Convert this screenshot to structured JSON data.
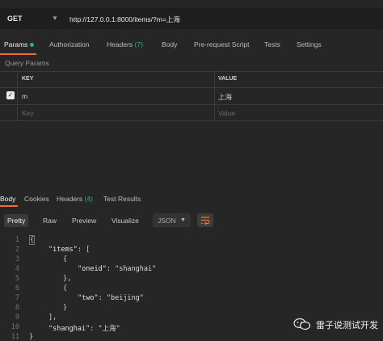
{
  "request": {
    "method": "GET",
    "url": "http://127.0.0.1:8000/items/?m=上海"
  },
  "tabs": [
    {
      "label": "Params"
    },
    {
      "label": "Authorization"
    },
    {
      "label": "Headers",
      "count": "(7)"
    },
    {
      "label": "Body"
    },
    {
      "label": "Pre-request Script"
    },
    {
      "label": "Tests"
    },
    {
      "label": "Settings"
    }
  ],
  "query_params": {
    "title": "Query Params",
    "headers": {
      "key": "KEY",
      "value": "VALUE"
    },
    "rows": [
      {
        "checked": true,
        "key": "m",
        "value": "上海"
      }
    ],
    "placeholder": {
      "key": "Key",
      "value": "Value"
    }
  },
  "response_tabs": [
    {
      "label": "Body"
    },
    {
      "label": "Cookies"
    },
    {
      "label": "Headers",
      "count": "(4)"
    },
    {
      "label": "Test Results"
    }
  ],
  "format_bar": {
    "pretty": "Pretty",
    "raw": "Raw",
    "preview": "Preview",
    "visualize": "Visualize",
    "format": "JSON"
  },
  "code_lines": [
    "1",
    "2",
    "3",
    "4",
    "5",
    "6",
    "7",
    "8",
    "9",
    "10",
    "11"
  ],
  "code": {
    "items_key": "\"items\"",
    "oneid_key": "\"oneid\"",
    "oneid_val": "\"shanghai\"",
    "two_key": "\"two\"",
    "two_val": "\"beijing\"",
    "shanghai_key": "\"shanghai\"",
    "shanghai_val": "\"上海\""
  },
  "watermark": "雷子说测试开发",
  "colors": {
    "accent": "#f26b3a",
    "indicator": "#2bb673",
    "background": "#262626"
  }
}
